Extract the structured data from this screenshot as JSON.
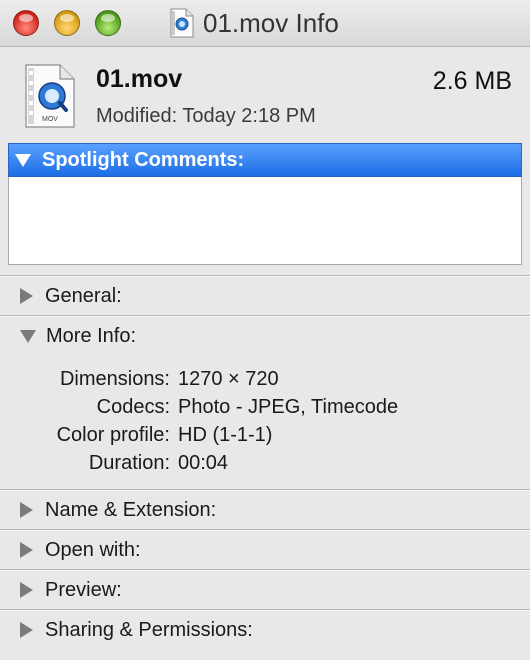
{
  "window": {
    "title": "01.mov Info"
  },
  "header": {
    "file_name": "01.mov",
    "file_size": "2.6 MB",
    "modified": "Modified: Today 2:18 PM",
    "icon_label": "MOV"
  },
  "spotlight": {
    "label": "Spotlight Comments:",
    "value": "",
    "accent": "#1c6ee4"
  },
  "sections": {
    "general": "General:",
    "more_info": "More Info:",
    "name_extension": "Name & Extension:",
    "open_with": "Open with:",
    "preview": "Preview:",
    "sharing": "Sharing & Permissions:"
  },
  "more_info": {
    "rows": [
      {
        "key": "Dimensions:",
        "value": "1270 × 720"
      },
      {
        "key": "Codecs:",
        "value": "Photo - JPEG, Timecode"
      },
      {
        "key": "Color profile:",
        "value": "HD (1-1-1)"
      },
      {
        "key": "Duration:",
        "value": "00:04"
      }
    ]
  },
  "icons": {
    "close": "close-button",
    "minimize": "minimize-button",
    "zoom": "zoom-button",
    "file": "quicktime-movie-icon"
  }
}
